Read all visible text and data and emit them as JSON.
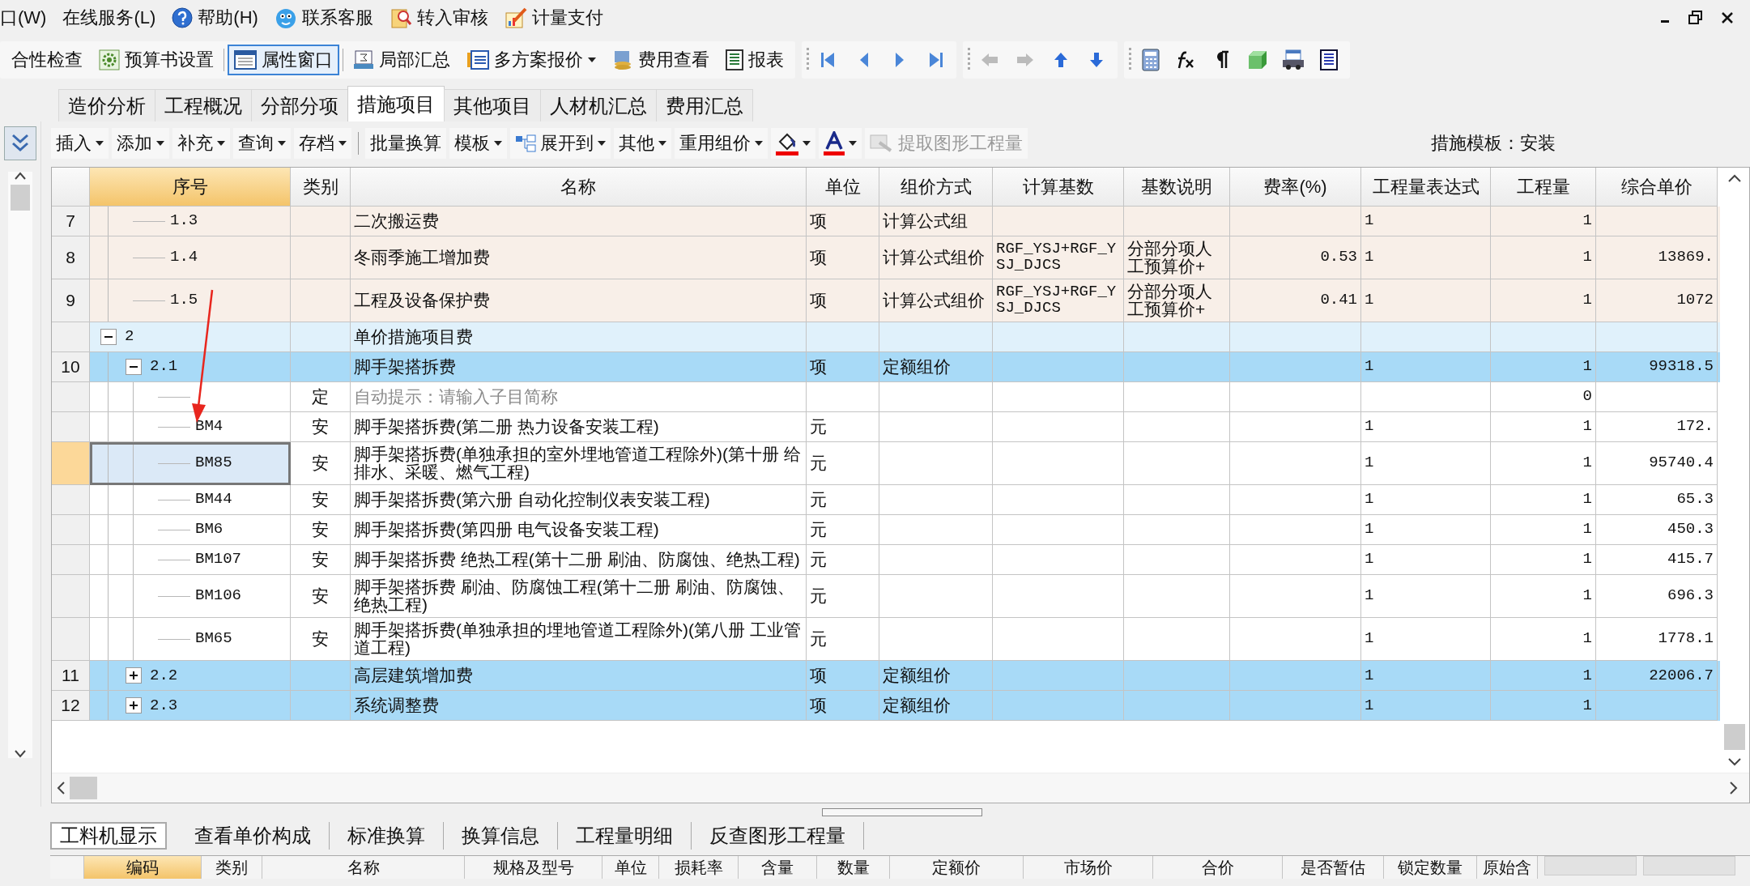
{
  "menu_bar": {
    "items": [
      {
        "label": "口(W)"
      },
      {
        "label": "在线服务(L)"
      },
      {
        "label": "帮助(H)"
      },
      {
        "label": "联系客服"
      },
      {
        "label": "转入审核"
      },
      {
        "label": "计量支付"
      }
    ]
  },
  "toolbar": {
    "items": [
      {
        "label": "合性检查",
        "pressed": false,
        "dropdown": false
      },
      {
        "label": "预算书设置",
        "pressed": false,
        "dropdown": false
      },
      {
        "label": "属性窗口",
        "pressed": true,
        "dropdown": false
      },
      {
        "label": "局部汇总",
        "pressed": false,
        "dropdown": false
      },
      {
        "label": "多方案报价",
        "pressed": false,
        "dropdown": true
      },
      {
        "label": "费用查看",
        "pressed": false,
        "dropdown": false
      },
      {
        "label": "报表",
        "pressed": false,
        "dropdown": false
      }
    ]
  },
  "view_tabs": [
    {
      "label": "造价分析",
      "selected": false
    },
    {
      "label": "工程概况",
      "selected": false
    },
    {
      "label": "分部分项",
      "selected": false
    },
    {
      "label": "措施项目",
      "selected": true
    },
    {
      "label": "其他项目",
      "selected": false
    },
    {
      "label": "人材机汇总",
      "selected": false
    },
    {
      "label": "费用汇总",
      "selected": false
    }
  ],
  "sub_toolbar": {
    "items": [
      {
        "kind": "button",
        "label": "插入",
        "dropdown": true,
        "disabled": false
      },
      {
        "kind": "button",
        "label": "添加",
        "dropdown": true,
        "disabled": false
      },
      {
        "kind": "button",
        "label": "补充",
        "dropdown": true,
        "disabled": false
      },
      {
        "kind": "button",
        "label": "查询",
        "dropdown": true,
        "disabled": false
      },
      {
        "kind": "button",
        "label": "存档",
        "dropdown": true,
        "disabled": false
      },
      {
        "kind": "separator"
      },
      {
        "kind": "button",
        "label": "批量换算",
        "dropdown": false,
        "disabled": false
      },
      {
        "kind": "button",
        "label": "模板",
        "dropdown": true,
        "disabled": false
      },
      {
        "kind": "expand",
        "label": "展开到",
        "dropdown": true,
        "disabled": false
      },
      {
        "kind": "button",
        "label": "其他",
        "dropdown": true,
        "disabled": false
      },
      {
        "kind": "button",
        "label": "重用组价",
        "dropdown": true,
        "disabled": false
      },
      {
        "kind": "fill",
        "dropdown": true,
        "disabled": false
      },
      {
        "kind": "fontcolor",
        "dropdown": true,
        "disabled": false
      },
      {
        "kind": "extract",
        "label": "提取图形工程量",
        "dropdown": false,
        "disabled": true
      }
    ],
    "template_label": "措施模板：安装"
  },
  "table": {
    "columns": [
      {
        "label": "序号",
        "active": true
      },
      {
        "label": "类别",
        "active": false
      },
      {
        "label": "名称",
        "active": false
      },
      {
        "label": "单位",
        "active": false
      },
      {
        "label": "组价方式",
        "active": false
      },
      {
        "label": "计算基数",
        "active": false
      },
      {
        "label": "基数说明",
        "active": false
      },
      {
        "label": "费率(%)",
        "active": false
      },
      {
        "label": "工程量表达式",
        "active": false
      },
      {
        "label": "工程量",
        "active": false
      },
      {
        "label": "综合单价",
        "active": false
      }
    ],
    "rows": [
      {
        "children": [
          {
            "kind": "formula",
            "selected": false,
            "row_no": "7",
            "seq": "1.3",
            "name": "二次搬运费",
            "unit": "项",
            "pricing_method": "计算公式组",
            "qty_expr": "1",
            "qty": "1"
          },
          {
            "kind": "formula",
            "selected": false,
            "row_no": "8",
            "seq": "1.4",
            "name": "冬雨季施工增加费",
            "unit": "项",
            "pricing_method": "计算公式组价",
            "calc_base": "RGF_YSJ+RGF_YSJ_DJCS",
            "base_note": "分部分项人工预算价+",
            "rate": "0.53",
            "qty_expr": "1",
            "qty": "1",
            "unit_price": "13869."
          },
          {
            "kind": "formula",
            "selected": false,
            "row_no": "9",
            "seq": "1.5",
            "name": "工程及设备保护费",
            "unit": "项",
            "pricing_method": "计算公式组价",
            "calc_base": "RGF_YSJ+RGF_YSJ_DJCS",
            "base_note": "分部分项人工预算价+",
            "rate": "0.41",
            "qty_expr": "1",
            "qty": "1",
            "unit_price": "1072"
          }
        ]
      },
      {
        "kind": "section",
        "selected": false,
        "seq": "2",
        "expanded": true,
        "name": "单价措施项目费",
        "children": [
          {
            "kind": "item",
            "selected": false,
            "row_no": "10",
            "seq": "2.1",
            "expanded": true,
            "name": "脚手架搭拆费",
            "unit": "项",
            "pricing_method": "定额组价",
            "qty_expr": "1",
            "qty": "1",
            "unit_price": "99318.5",
            "children": [
              {
                "kind": "prompt",
                "selected": false,
                "type": "定",
                "name": "自动提示：请输入子目简称",
                "qty": "0"
              },
              {
                "kind": "entry",
                "selected": false,
                "seq": "BM4",
                "type": "安",
                "name": "脚手架搭拆费(第二册 热力设备安装工程)",
                "unit": "元",
                "qty_expr": "1",
                "qty": "1",
                "unit_price": "172."
              },
              {
                "kind": "entry",
                "selected": true,
                "seq": "BM85",
                "type": "安",
                "name": "脚手架搭拆费(单独承担的室外埋地管道工程除外)(第十册 给排水、采暖、燃气工程)",
                "unit": "元",
                "qty_expr": "1",
                "qty": "1",
                "unit_price": "95740.4"
              },
              {
                "kind": "entry",
                "selected": false,
                "seq": "BM44",
                "type": "安",
                "name": "脚手架搭拆费(第六册 自动化控制仪表安装工程)",
                "unit": "元",
                "qty_expr": "1",
                "qty": "1",
                "unit_price": "65.3"
              },
              {
                "kind": "entry",
                "selected": false,
                "seq": "BM6",
                "type": "安",
                "name": "脚手架搭拆费(第四册 电气设备安装工程)",
                "unit": "元",
                "qty_expr": "1",
                "qty": "1",
                "unit_price": "450.3"
              },
              {
                "kind": "entry",
                "selected": false,
                "seq": "BM107",
                "type": "安",
                "name": "脚手架搭拆费 绝热工程(第十二册 刷油、防腐蚀、绝热工程)",
                "unit": "元",
                "qty_expr": "1",
                "qty": "1",
                "unit_price": "415.7"
              },
              {
                "kind": "entry",
                "selected": false,
                "seq": "BM106",
                "type": "安",
                "name": "脚手架搭拆费 刷油、防腐蚀工程(第十二册 刷油、防腐蚀、绝热工程)",
                "unit": "元",
                "qty_expr": "1",
                "qty": "1",
                "unit_price": "696.3"
              },
              {
                "kind": "entry",
                "selected": false,
                "seq": "BM65",
                "type": "安",
                "name": "脚手架搭拆费(单独承担的埋地管道工程除外)(第八册 工业管道工程)",
                "unit": "元",
                "qty_expr": "1",
                "qty": "1",
                "unit_price": "1778.1"
              }
            ]
          },
          {
            "kind": "item",
            "selected": false,
            "row_no": "11",
            "seq": "2.2",
            "expanded": false,
            "name": "高层建筑增加费",
            "unit": "项",
            "pricing_method": "定额组价",
            "qty_expr": "1",
            "qty": "1",
            "unit_price": "22006.7"
          },
          {
            "kind": "item",
            "selected": false,
            "row_no": "12",
            "seq": "2.3",
            "expanded": false,
            "name": "系统调整费",
            "unit": "项",
            "pricing_method": "定额组价",
            "qty_expr": "1",
            "qty": "1"
          }
        ]
      }
    ]
  },
  "bottom_panel": {
    "tabs": [
      {
        "label": "工料机显示",
        "selected": true
      },
      {
        "label": "查看单价构成",
        "selected": false
      },
      {
        "label": "标准换算",
        "selected": false
      },
      {
        "label": "换算信息",
        "selected": false
      },
      {
        "label": "工程量明细",
        "selected": false
      },
      {
        "label": "反查图形工程量",
        "selected": false
      }
    ],
    "columns": [
      {
        "label": "编码",
        "active": true
      },
      {
        "label": "类别",
        "active": false
      },
      {
        "label": "名称",
        "active": false
      },
      {
        "label": "规格及型号",
        "active": false
      },
      {
        "label": "单位",
        "active": false
      },
      {
        "label": "损耗率",
        "active": false
      },
      {
        "label": "含量",
        "active": false
      },
      {
        "label": "数量",
        "active": false
      },
      {
        "label": "定额价",
        "active": false
      },
      {
        "label": "市场价",
        "active": false
      },
      {
        "label": "合价",
        "active": false
      },
      {
        "label": "是否暂估",
        "active": false
      },
      {
        "label": "锁定数量",
        "active": false
      },
      {
        "label": "原始含",
        "active": false
      }
    ]
  }
}
